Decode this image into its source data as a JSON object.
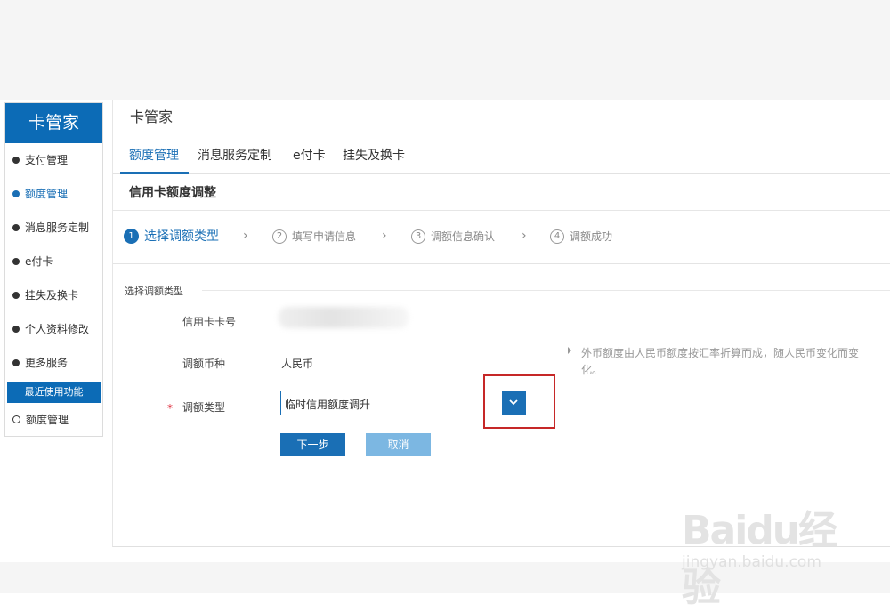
{
  "sidebar": {
    "title": "卡管家",
    "items": [
      {
        "label": "支付管理"
      },
      {
        "label": "额度管理"
      },
      {
        "label": "消息服务定制"
      },
      {
        "label": "e付卡"
      },
      {
        "label": "挂失及换卡"
      },
      {
        "label": "个人资料修改"
      },
      {
        "label": "更多服务"
      }
    ],
    "recent_title": "最近使用功能",
    "recent_item": "额度管理"
  },
  "main": {
    "title": "卡管家",
    "tabs": [
      {
        "label": "额度管理"
      },
      {
        "label": "消息服务定制"
      },
      {
        "label": "e付卡"
      },
      {
        "label": "挂失及换卡"
      }
    ],
    "section_title": "信用卡额度调整",
    "steps": [
      {
        "num": "1",
        "label": "选择调额类型"
      },
      {
        "num": "2",
        "label": "填写申请信息"
      },
      {
        "num": "3",
        "label": "调额信息确认"
      },
      {
        "num": "4",
        "label": "调额成功"
      }
    ],
    "step_arrow": "›"
  },
  "form": {
    "group_title": "选择调额类型",
    "card_label": "信用卡卡号",
    "currency_label": "调额币种",
    "currency_value": "人民币",
    "type_label": "调额类型",
    "required_mark": "*",
    "type_value": "临时信用额度调升",
    "next_button": "下一步",
    "cancel_button": "取消",
    "note": "外币额度由人民币额度按汇率折算而成，随人民币变化而变化。"
  },
  "watermark": {
    "logo": "Baidu经验",
    "url": "jingyan.baidu.com"
  }
}
